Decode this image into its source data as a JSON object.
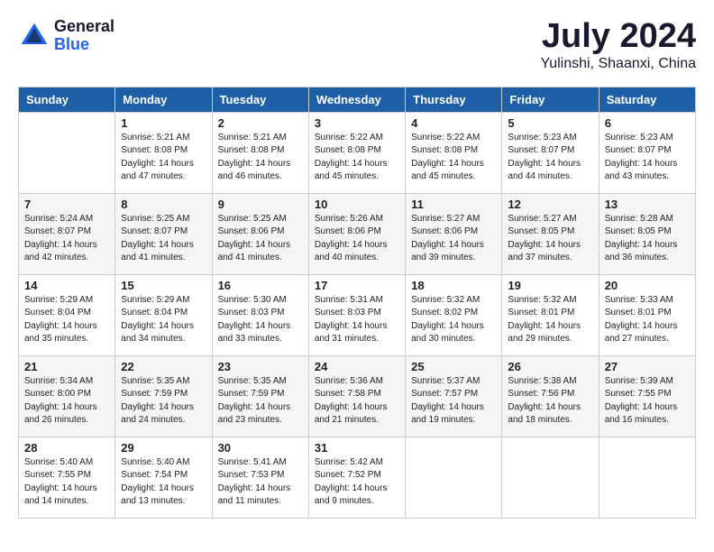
{
  "header": {
    "logo_general": "General",
    "logo_blue": "Blue",
    "month_year": "July 2024",
    "location": "Yulinshi, Shaanxi, China"
  },
  "weekdays": [
    "Sunday",
    "Monday",
    "Tuesday",
    "Wednesday",
    "Thursday",
    "Friday",
    "Saturday"
  ],
  "weeks": [
    [
      {
        "day": "",
        "text": ""
      },
      {
        "day": "1",
        "text": "Sunrise: 5:21 AM\nSunset: 8:08 PM\nDaylight: 14 hours\nand 47 minutes."
      },
      {
        "day": "2",
        "text": "Sunrise: 5:21 AM\nSunset: 8:08 PM\nDaylight: 14 hours\nand 46 minutes."
      },
      {
        "day": "3",
        "text": "Sunrise: 5:22 AM\nSunset: 8:08 PM\nDaylight: 14 hours\nand 45 minutes."
      },
      {
        "day": "4",
        "text": "Sunrise: 5:22 AM\nSunset: 8:08 PM\nDaylight: 14 hours\nand 45 minutes."
      },
      {
        "day": "5",
        "text": "Sunrise: 5:23 AM\nSunset: 8:07 PM\nDaylight: 14 hours\nand 44 minutes."
      },
      {
        "day": "6",
        "text": "Sunrise: 5:23 AM\nSunset: 8:07 PM\nDaylight: 14 hours\nand 43 minutes."
      }
    ],
    [
      {
        "day": "7",
        "text": "Sunrise: 5:24 AM\nSunset: 8:07 PM\nDaylight: 14 hours\nand 42 minutes."
      },
      {
        "day": "8",
        "text": "Sunrise: 5:25 AM\nSunset: 8:07 PM\nDaylight: 14 hours\nand 41 minutes."
      },
      {
        "day": "9",
        "text": "Sunrise: 5:25 AM\nSunset: 8:06 PM\nDaylight: 14 hours\nand 41 minutes."
      },
      {
        "day": "10",
        "text": "Sunrise: 5:26 AM\nSunset: 8:06 PM\nDaylight: 14 hours\nand 40 minutes."
      },
      {
        "day": "11",
        "text": "Sunrise: 5:27 AM\nSunset: 8:06 PM\nDaylight: 14 hours\nand 39 minutes."
      },
      {
        "day": "12",
        "text": "Sunrise: 5:27 AM\nSunset: 8:05 PM\nDaylight: 14 hours\nand 37 minutes."
      },
      {
        "day": "13",
        "text": "Sunrise: 5:28 AM\nSunset: 8:05 PM\nDaylight: 14 hours\nand 36 minutes."
      }
    ],
    [
      {
        "day": "14",
        "text": "Sunrise: 5:29 AM\nSunset: 8:04 PM\nDaylight: 14 hours\nand 35 minutes."
      },
      {
        "day": "15",
        "text": "Sunrise: 5:29 AM\nSunset: 8:04 PM\nDaylight: 14 hours\nand 34 minutes."
      },
      {
        "day": "16",
        "text": "Sunrise: 5:30 AM\nSunset: 8:03 PM\nDaylight: 14 hours\nand 33 minutes."
      },
      {
        "day": "17",
        "text": "Sunrise: 5:31 AM\nSunset: 8:03 PM\nDaylight: 14 hours\nand 31 minutes."
      },
      {
        "day": "18",
        "text": "Sunrise: 5:32 AM\nSunset: 8:02 PM\nDaylight: 14 hours\nand 30 minutes."
      },
      {
        "day": "19",
        "text": "Sunrise: 5:32 AM\nSunset: 8:01 PM\nDaylight: 14 hours\nand 29 minutes."
      },
      {
        "day": "20",
        "text": "Sunrise: 5:33 AM\nSunset: 8:01 PM\nDaylight: 14 hours\nand 27 minutes."
      }
    ],
    [
      {
        "day": "21",
        "text": "Sunrise: 5:34 AM\nSunset: 8:00 PM\nDaylight: 14 hours\nand 26 minutes."
      },
      {
        "day": "22",
        "text": "Sunrise: 5:35 AM\nSunset: 7:59 PM\nDaylight: 14 hours\nand 24 minutes."
      },
      {
        "day": "23",
        "text": "Sunrise: 5:35 AM\nSunset: 7:59 PM\nDaylight: 14 hours\nand 23 minutes."
      },
      {
        "day": "24",
        "text": "Sunrise: 5:36 AM\nSunset: 7:58 PM\nDaylight: 14 hours\nand 21 minutes."
      },
      {
        "day": "25",
        "text": "Sunrise: 5:37 AM\nSunset: 7:57 PM\nDaylight: 14 hours\nand 19 minutes."
      },
      {
        "day": "26",
        "text": "Sunrise: 5:38 AM\nSunset: 7:56 PM\nDaylight: 14 hours\nand 18 minutes."
      },
      {
        "day": "27",
        "text": "Sunrise: 5:39 AM\nSunset: 7:55 PM\nDaylight: 14 hours\nand 16 minutes."
      }
    ],
    [
      {
        "day": "28",
        "text": "Sunrise: 5:40 AM\nSunset: 7:55 PM\nDaylight: 14 hours\nand 14 minutes."
      },
      {
        "day": "29",
        "text": "Sunrise: 5:40 AM\nSunset: 7:54 PM\nDaylight: 14 hours\nand 13 minutes."
      },
      {
        "day": "30",
        "text": "Sunrise: 5:41 AM\nSunset: 7:53 PM\nDaylight: 14 hours\nand 11 minutes."
      },
      {
        "day": "31",
        "text": "Sunrise: 5:42 AM\nSunset: 7:52 PM\nDaylight: 14 hours\nand 9 minutes."
      },
      {
        "day": "",
        "text": ""
      },
      {
        "day": "",
        "text": ""
      },
      {
        "day": "",
        "text": ""
      }
    ]
  ]
}
